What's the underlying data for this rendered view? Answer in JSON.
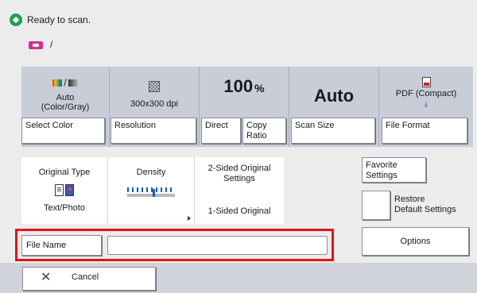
{
  "status": {
    "message": "Ready to scan.",
    "destination_separator": "/"
  },
  "settings": {
    "color": {
      "value": "Auto\n(Color/Gray)",
      "button": "Select Color",
      "icon": "color-gray-icon"
    },
    "resolution": {
      "value": "300x300 dpi",
      "button": "Resolution",
      "icon": "resolution-icon"
    },
    "ratio": {
      "value": "100",
      "unit": "%",
      "direct_button": "Direct",
      "copy_ratio_button": "Copy\nRatio"
    },
    "scan_size": {
      "value": "Auto",
      "button": "Scan Size"
    },
    "file_format": {
      "value": "PDF (Compact)",
      "button": "File Format",
      "icon": "pdf-icon"
    }
  },
  "functions": {
    "original_type": {
      "title": "Original Type",
      "value": "Text/Photo",
      "icon": "text-photo-icon"
    },
    "density": {
      "title": "Density",
      "level": 0.55
    },
    "two_sided": {
      "title": "2-Sided Original\nSettings",
      "value": "1-Sided Original"
    }
  },
  "side": {
    "favorite": "Favorite\nSettings",
    "restore": "Restore\nDefault Settings",
    "options": "Options"
  },
  "file_name": {
    "label": "File Name",
    "value": ""
  },
  "bottom": {
    "cancel": "Cancel"
  },
  "colors": {
    "highlight": "#e31414",
    "accent": "#1a5bbf",
    "panel": "#c9cdd8"
  }
}
